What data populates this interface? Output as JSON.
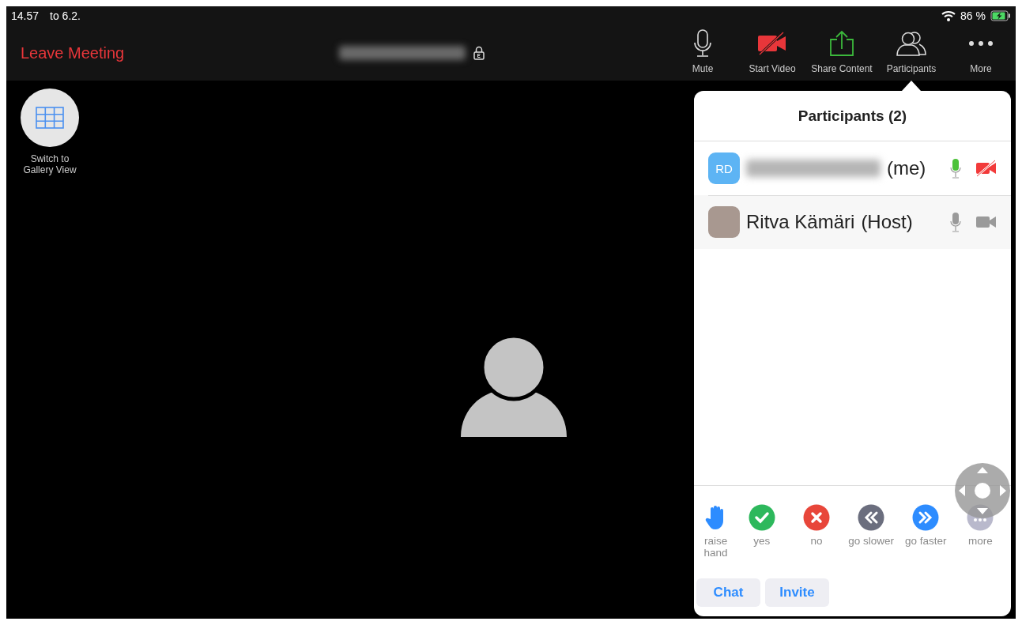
{
  "status_bar": {
    "time": "14.57",
    "date": "to 6.2.",
    "battery": "86 %",
    "charging": true
  },
  "toolbar": {
    "leave_label": "Leave Meeting",
    "meeting_id_blurred": true,
    "locked": true,
    "buttons": [
      {
        "kind": "mic",
        "label": "Mute",
        "selected": false
      },
      {
        "kind": "video_off",
        "label": "Start Video",
        "selected": false
      },
      {
        "kind": "share",
        "label": "Share Content",
        "selected": false
      },
      {
        "kind": "participants",
        "label": "Participants",
        "selected": true
      },
      {
        "kind": "more",
        "label": "More",
        "selected": false
      }
    ]
  },
  "gallery_button": {
    "label": "Switch to Gallery View"
  },
  "participants_panel": {
    "title": "Participants (2)",
    "participants": [
      {
        "has_photo": false,
        "initials": "RD",
        "name_blurred": true,
        "suffix": "(me)",
        "mic_active": true,
        "video_on": false,
        "highlighted": false
      },
      {
        "has_photo": true,
        "name_blurred": false,
        "name": "Ritva Kämäri",
        "suffix": "(Host)",
        "mic_active": false,
        "video_on": true,
        "highlighted": true
      }
    ],
    "reactions": [
      {
        "kind": "hand",
        "label": "raise hand"
      },
      {
        "kind": "yes",
        "label": "yes"
      },
      {
        "kind": "no",
        "label": "no"
      },
      {
        "kind": "slower",
        "label": "go slower"
      },
      {
        "kind": "faster",
        "label": "go faster"
      },
      {
        "kind": "more",
        "label": "more"
      }
    ],
    "buttons": [
      "Chat",
      "Invite"
    ]
  }
}
